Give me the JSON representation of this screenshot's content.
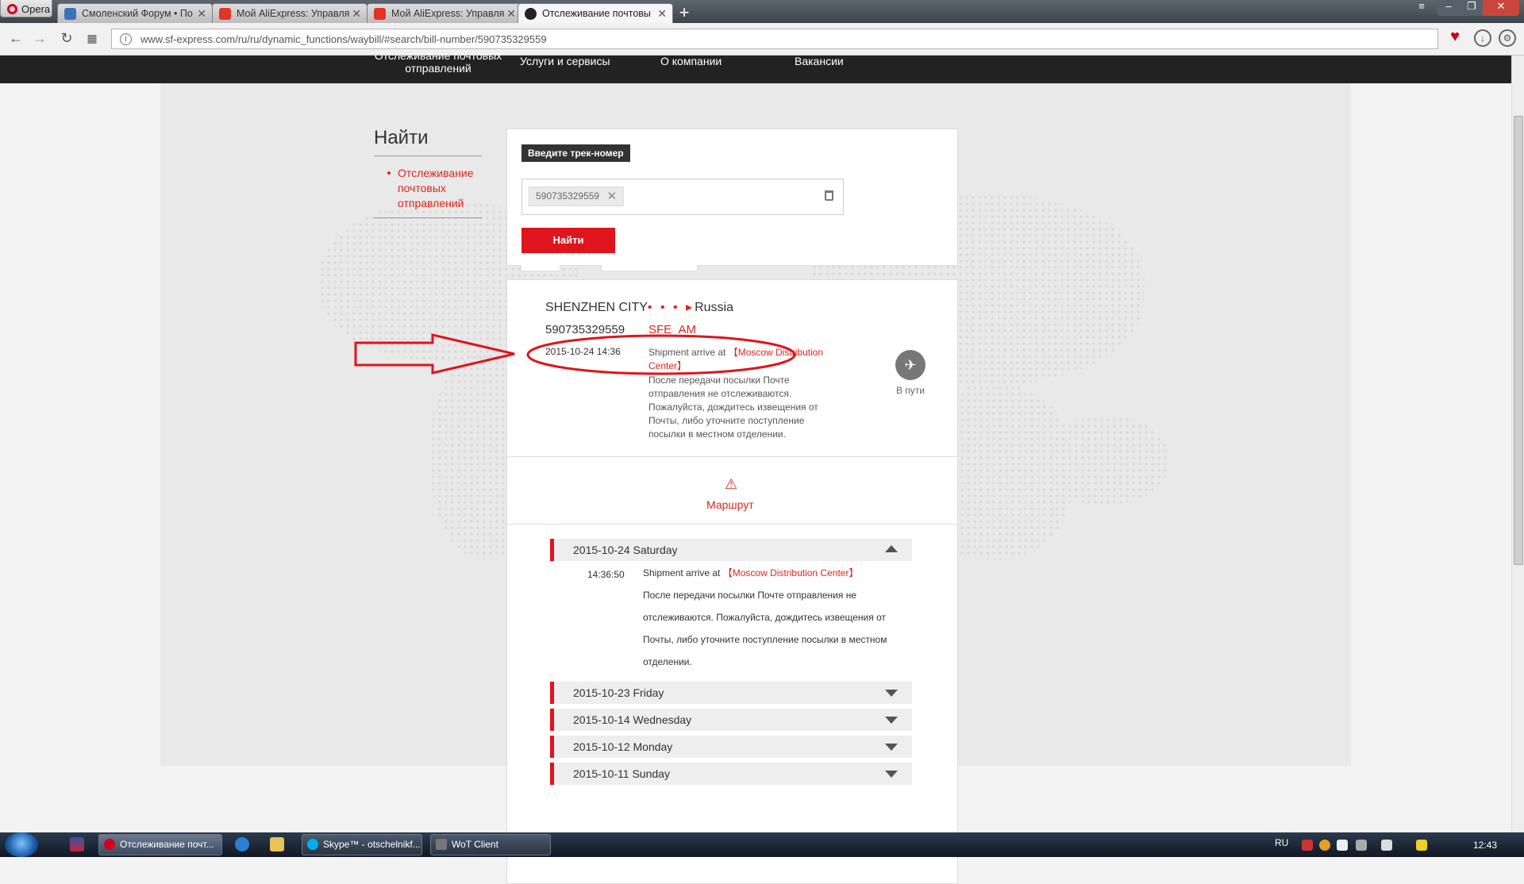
{
  "browser": {
    "menu_label": "Opera",
    "tabs": [
      {
        "title": "Смоленский Форум • По"
      },
      {
        "title": "Мой AliExpress: Управля"
      },
      {
        "title": "Мой AliExpress: Управля"
      },
      {
        "title": "Отслеживание почтовы"
      }
    ],
    "new_tab": "+",
    "url": "www.sf-express.com/ru/ru/dynamic_functions/waybill/#search/bill-number/590735329559"
  },
  "site_nav": {
    "items": [
      "Отслеживание почтовых отправлений",
      "Услуги и сервисы",
      "О компании",
      "Вакансии"
    ]
  },
  "sidebar": {
    "title": "Найти",
    "link": "Отслеживание почтовых отправлений"
  },
  "search": {
    "label": "Введите трек-номер",
    "chip_value": "590735329559",
    "button": "Найти"
  },
  "result": {
    "origin": "SHENZHEN CITY",
    "dots": "• • • ▸",
    "destination": "Russia",
    "bill_number": "590735329559",
    "carrier": "SFE_AM",
    "datetime": "2015-10-24 14:36",
    "event_prefix": "Shipment arrive at",
    "event_location": "【Moscow Distribution Center】",
    "event_note": "После передачи посылки Почте отправления не отслеживаются. Пожалуйста, дождитесь извещения от Почты, либо уточните поступление посылки в местном отделении.",
    "status_label": "В пути"
  },
  "route": {
    "label": "Маршрут"
  },
  "timeline": {
    "expanded_day": "2015-10-24 Saturday",
    "event_time": "14:36:50",
    "event_prefix": "Shipment arrive at",
    "event_location": "【Moscow Distribution Center】",
    "event_note": "После передачи посылки Почте отправления не отслеживаются. Пожалуйста, дождитесь извещения от Почты, либо уточните поступление посылки в местном отделении.",
    "collapsed_days": [
      "2015-10-23 Friday",
      "2015-10-14 Wednesday",
      "2015-10-12 Monday",
      "2015-10-11 Sunday"
    ]
  },
  "taskbar": {
    "buttons": [
      "Отслеживание почт...",
      "Skype™ - otschelnikf...",
      "WoT Client"
    ],
    "lang": "RU",
    "clock": "12:43"
  },
  "colors": {
    "accent_red": "#e0141c",
    "nav_dark": "#222222",
    "annotation_red": "#e0141c"
  }
}
